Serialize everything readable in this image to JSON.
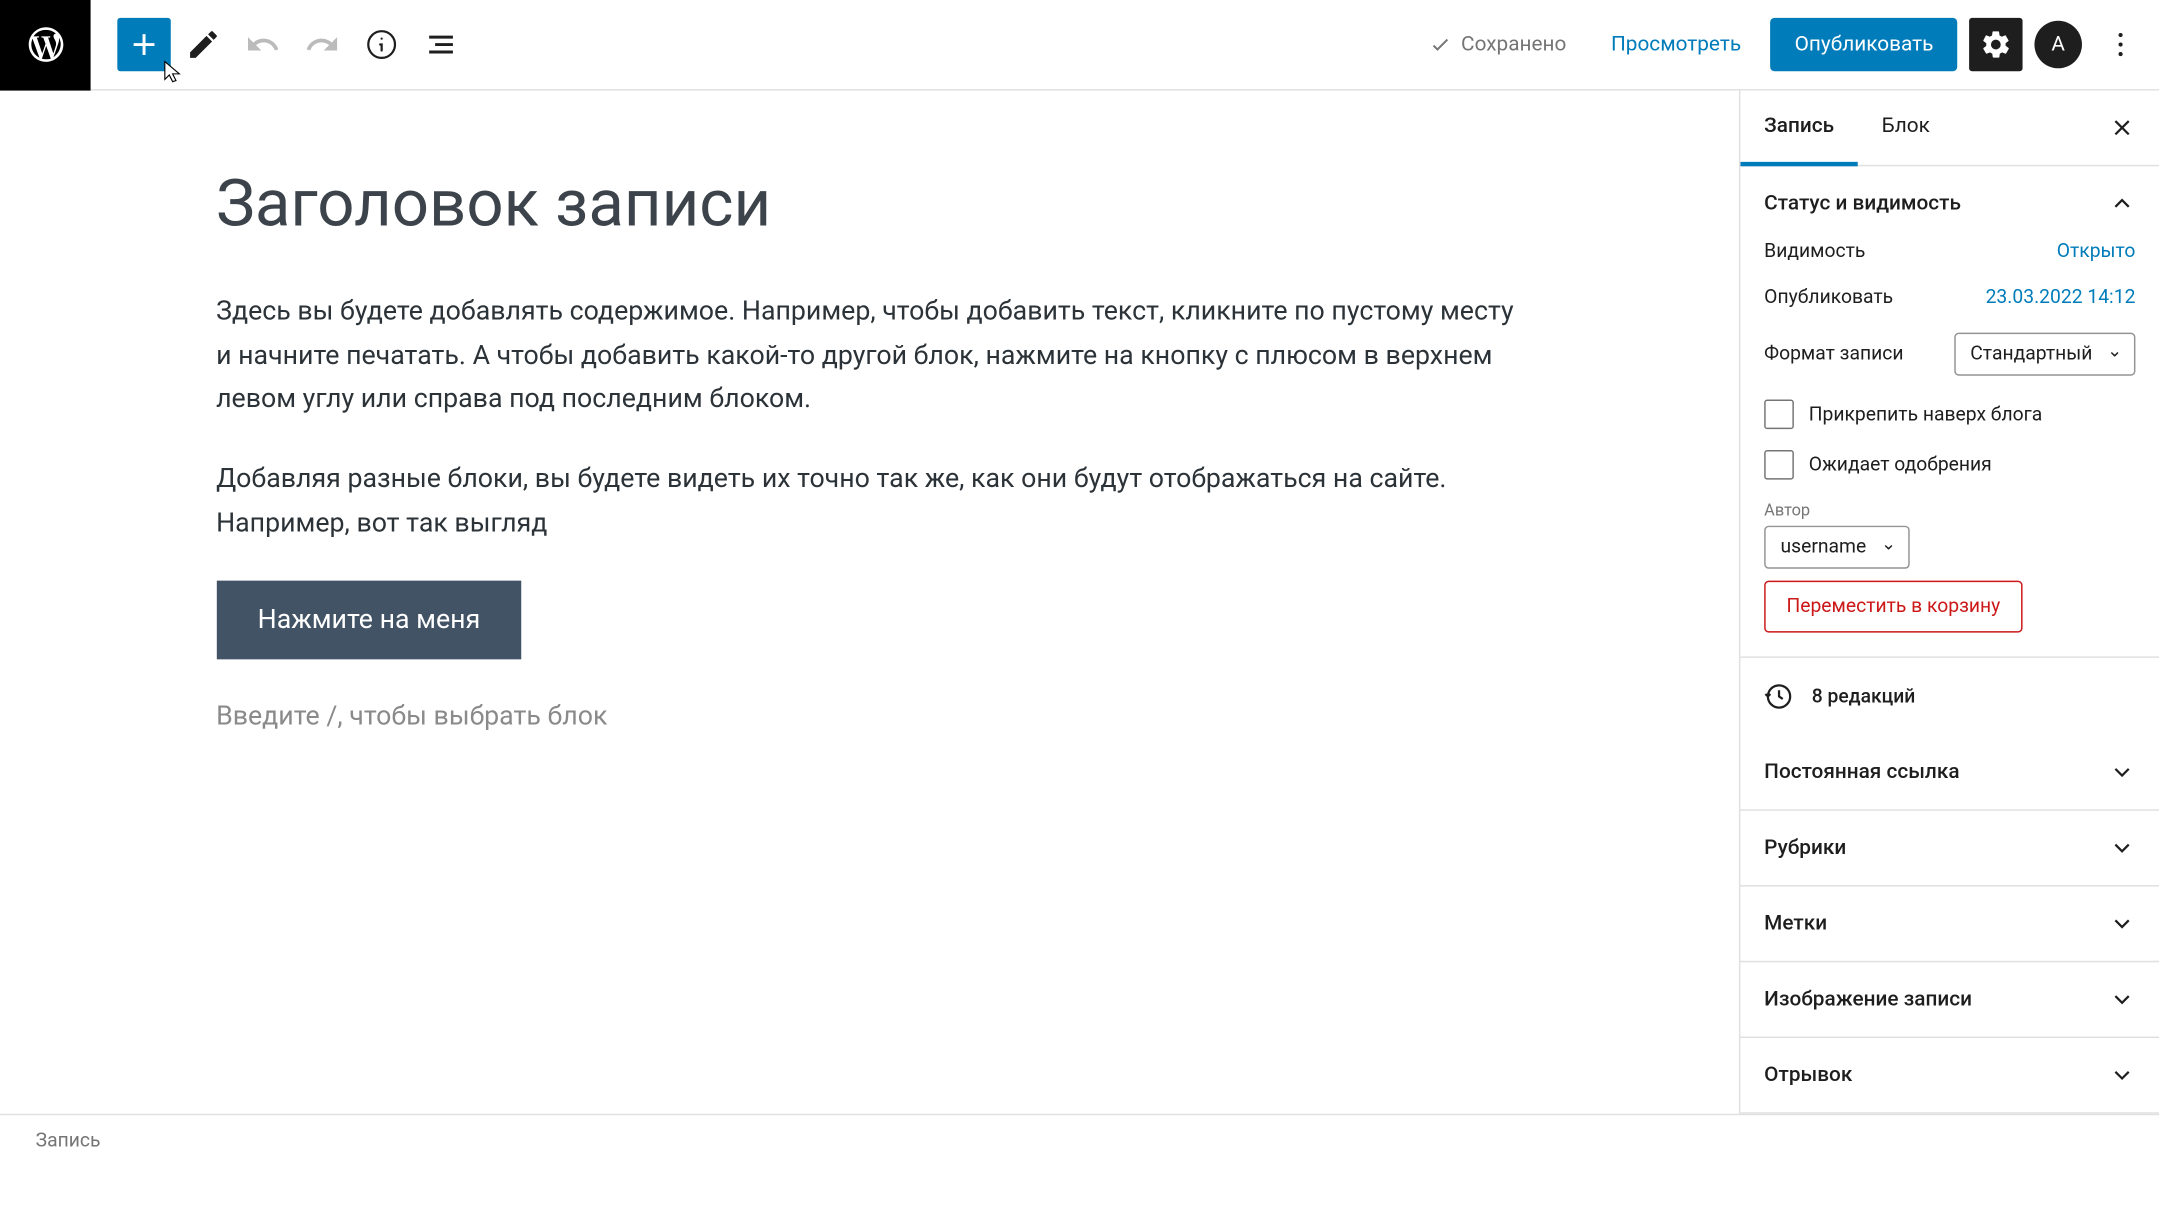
{
  "topbar": {
    "saved": "Сохранено",
    "preview": "Просмотреть",
    "publish": "Опубликовать",
    "avatar_initial": "A"
  },
  "editor": {
    "title": "Заголовок записи",
    "para1": "Здесь вы будете добавлять содержимое. Например, чтобы добавить текст, кликните по пустому месту и начните печатать. А чтобы добавить какой-то другой блок, нажмите на кнопку с плюсом в верхнем левом углу или справа под последним блоком.",
    "para2": "Добавляя разные блоки, вы будете видеть их точно так же, как они будут отображаться на сайте. Например, вот так выгляд",
    "button_text": "Нажмите на меня",
    "placeholder": "Введите /, чтобы выбрать блок"
  },
  "sidebar": {
    "tabs": {
      "post": "Запись",
      "block": "Блок"
    },
    "status_panel": {
      "title": "Статус и видимость",
      "visibility_label": "Видимость",
      "visibility_value": "Открыто",
      "publish_label": "Опубликовать",
      "publish_value": "23.03.2022 14:12",
      "format_label": "Формат записи",
      "format_value": "Стандартный",
      "sticky_label": "Прикрепить наверх блога",
      "pending_label": "Ожидает одобрения",
      "author_label": "Автор",
      "author_value": "username",
      "trash": "Переместить в корзину"
    },
    "revisions": "8 редакций",
    "panels": {
      "permalink": "Постоянная ссылка",
      "categories": "Рубрики",
      "tags": "Метки",
      "featured": "Изображение записи",
      "excerpt": "Отрывок"
    }
  },
  "breadcrumb": "Запись"
}
